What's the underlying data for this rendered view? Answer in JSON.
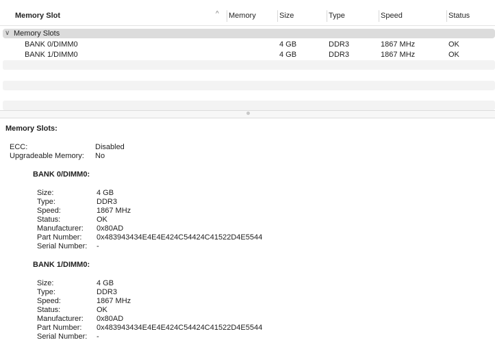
{
  "table": {
    "columns": [
      "Memory Slot",
      "Memory",
      "Size",
      "Type",
      "Speed",
      "Status"
    ],
    "sort_glyph": "^",
    "group_label": "Memory Slots",
    "group_chevron": "∨",
    "rows": [
      {
        "slot": "BANK 0/DIMM0",
        "memory": "",
        "size": "4 GB",
        "type": "DDR3",
        "speed": "1867 MHz",
        "status": "OK"
      },
      {
        "slot": "BANK 1/DIMM0",
        "memory": "",
        "size": "4 GB",
        "type": "DDR3",
        "speed": "1867 MHz",
        "status": "OK"
      }
    ]
  },
  "details": {
    "title": "Memory Slots:",
    "summary": [
      {
        "label": "ECC:",
        "value": "Disabled"
      },
      {
        "label": "Upgradeable Memory:",
        "value": "No"
      }
    ],
    "banks": [
      {
        "title": "BANK 0/DIMM0:",
        "fields": [
          {
            "label": "Size:",
            "value": "4 GB"
          },
          {
            "label": "Type:",
            "value": "DDR3"
          },
          {
            "label": "Speed:",
            "value": "1867 MHz"
          },
          {
            "label": "Status:",
            "value": "OK"
          },
          {
            "label": "Manufacturer:",
            "value": "0x80AD"
          },
          {
            "label": "Part Number:",
            "value": "0x483943434E4E4E424C54424C41522D4E5544"
          },
          {
            "label": "Serial Number:",
            "value": "-"
          }
        ]
      },
      {
        "title": "BANK 1/DIMM0:",
        "fields": [
          {
            "label": "Size:",
            "value": "4 GB"
          },
          {
            "label": "Type:",
            "value": "DDR3"
          },
          {
            "label": "Speed:",
            "value": "1867 MHz"
          },
          {
            "label": "Status:",
            "value": "OK"
          },
          {
            "label": "Manufacturer:",
            "value": "0x80AD"
          },
          {
            "label": "Part Number:",
            "value": "0x483943434E4E4E424C54424C41522D4E5544"
          },
          {
            "label": "Serial Number:",
            "value": "-"
          }
        ]
      }
    ]
  }
}
